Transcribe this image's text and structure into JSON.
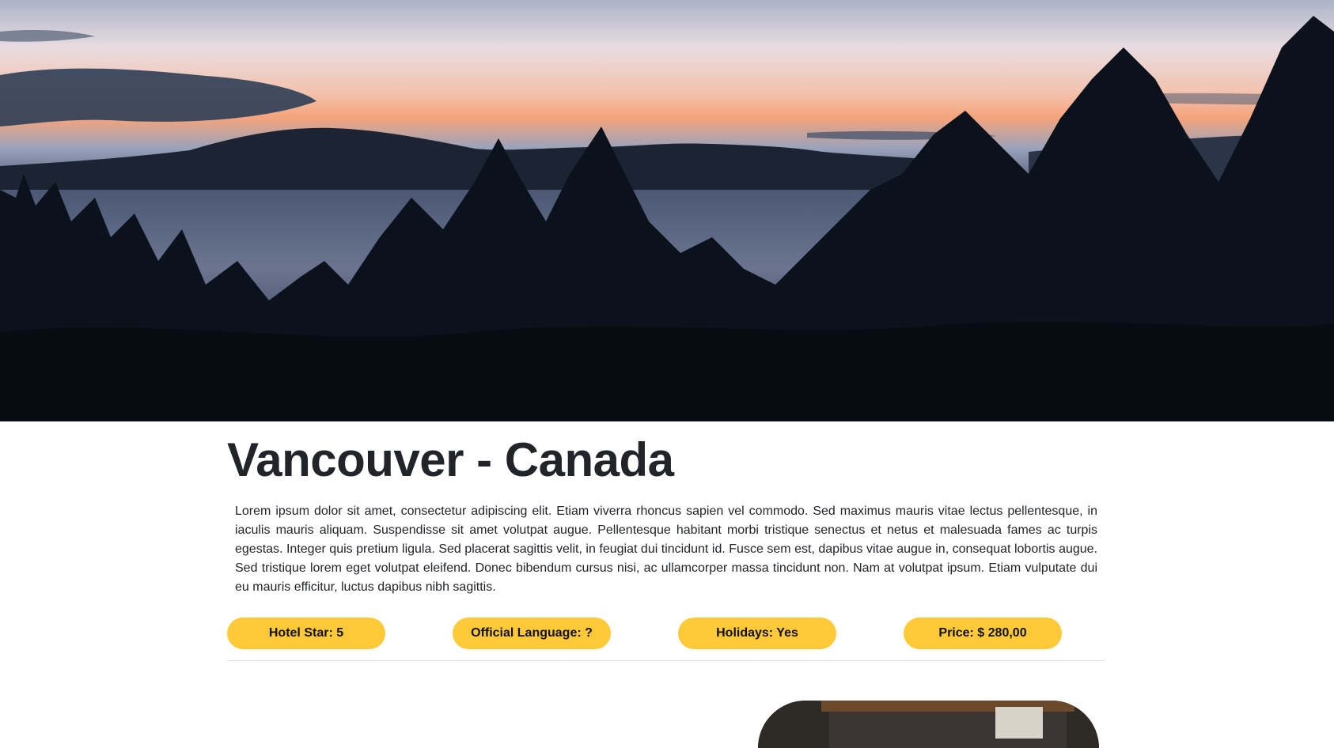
{
  "hero": {
    "image": "sunset-lake-with-pine-trees"
  },
  "destination": {
    "title": "Vancouver - Canada",
    "description": "Lorem ipsum dolor sit amet, consectetur adipiscing elit. Etiam viverra rhoncus sapien vel commodo. Sed maximus mauris vitae lectus pellentesque, in iaculis mauris aliquam. Suspendisse sit amet volutpat augue. Pellentesque habitant morbi tristique senectus et netus et malesuada fames ac turpis egestas. Integer quis pretium ligula. Sed placerat sagittis velit, in feugiat dui tincidunt id. Fusce sem est, dapibus vitae augue in, consequat lobortis augue. Sed tristique lorem eget volutpat eleifend. Donec bibendum cursus nisi, ac ullamcorper massa tincidunt non. Nam at volutpat ipsum. Etiam vulputate dui eu mauris efficitur, luctus dapibus nibh sagittis."
  },
  "badges": [
    {
      "label": "Hotel Star: 5"
    },
    {
      "label": "Official Language: ?"
    },
    {
      "label": "Holidays: Yes"
    },
    {
      "label": "Price: $ 280,00"
    }
  ],
  "colors": {
    "badge_bg": "#ffc938",
    "title_text": "#212529",
    "divider": "#e3e3e3"
  },
  "thumbnail": {
    "image": "hotel-interior-photo"
  }
}
